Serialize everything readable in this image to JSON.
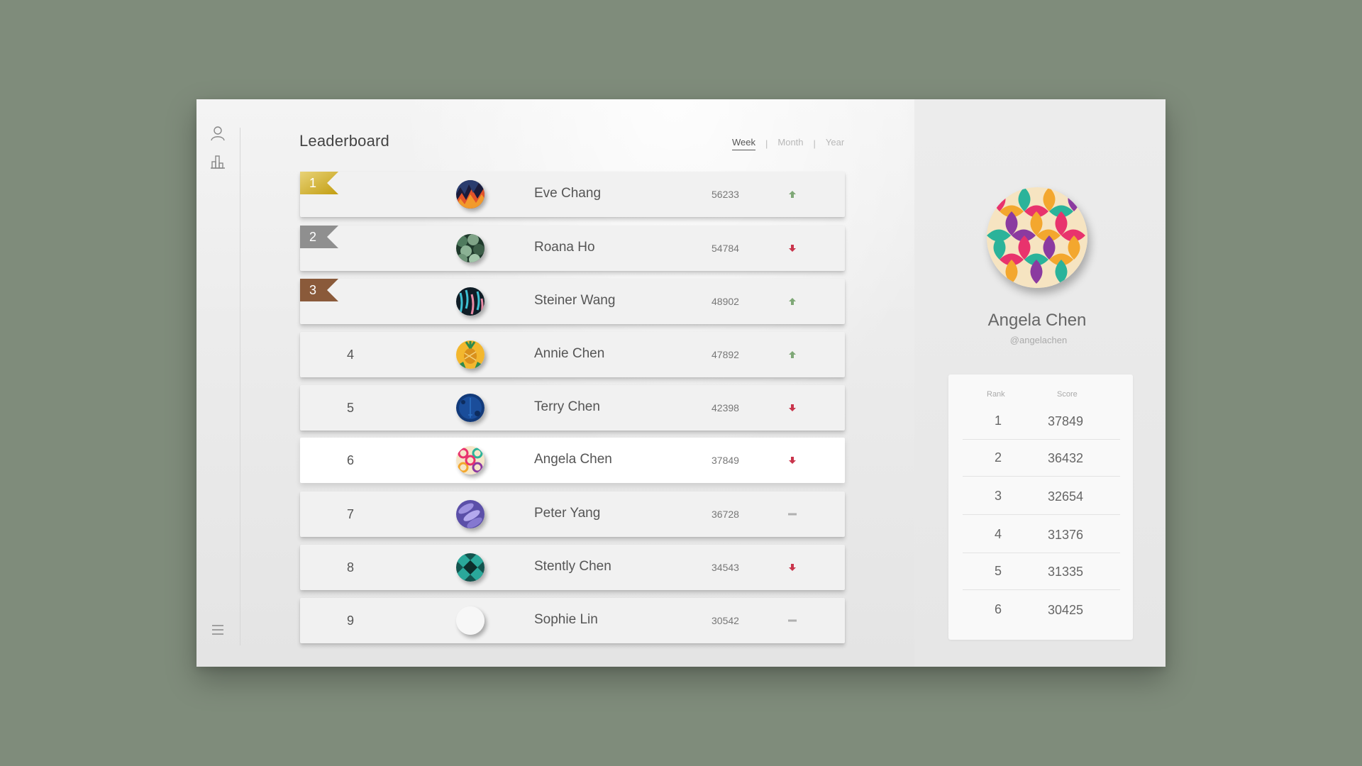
{
  "app": {
    "title": "Leaderboard",
    "period_tabs": [
      {
        "label": "Week",
        "active": true
      },
      {
        "label": "Month",
        "active": false
      },
      {
        "label": "Year",
        "active": false
      }
    ],
    "separator": "|"
  },
  "sidebar": {
    "icons": [
      "user-icon",
      "bar-chart-icon",
      "menu-icon"
    ]
  },
  "colors": {
    "background": "#7f8c7b",
    "gold": "#d9b51c",
    "silver": "#8f8f8f",
    "bronze": "#8a5a3a",
    "trend_up": "#7fa877",
    "trend_down": "#c9344b",
    "trend_same": "#b0b0b0"
  },
  "leaderboard": [
    {
      "rank": "1",
      "name": "Eve Chang",
      "score": "56233",
      "trend": "up",
      "medal": "gold",
      "avatar": "avatar-eve-chang"
    },
    {
      "rank": "2",
      "name": "Roana Ho",
      "score": "54784",
      "trend": "down",
      "medal": "silver",
      "avatar": "avatar-roana-ho"
    },
    {
      "rank": "3",
      "name": "Steiner Wang",
      "score": "48902",
      "trend": "up",
      "medal": "bronze",
      "avatar": "avatar-steiner-wang"
    },
    {
      "rank": "4",
      "name": "Annie Chen",
      "score": "47892",
      "trend": "up",
      "medal": "",
      "avatar": "avatar-annie-chen"
    },
    {
      "rank": "5",
      "name": "Terry Chen",
      "score": "42398",
      "trend": "down",
      "medal": "",
      "avatar": "avatar-terry-chen"
    },
    {
      "rank": "6",
      "name": "Angela Chen",
      "score": "37849",
      "trend": "down",
      "medal": "",
      "avatar": "avatar-angela-chen",
      "highlight": true
    },
    {
      "rank": "7",
      "name": "Peter Yang",
      "score": "36728",
      "trend": "same",
      "medal": "",
      "avatar": "avatar-peter-yang"
    },
    {
      "rank": "8",
      "name": "Stently Chen",
      "score": "34543",
      "trend": "down",
      "medal": "",
      "avatar": "avatar-stently-chen"
    },
    {
      "rank": "9",
      "name": "Sophie Lin",
      "score": "30542",
      "trend": "same",
      "medal": "",
      "avatar": "avatar-sophie-lin"
    }
  ],
  "profile": {
    "name": "Angela Chen",
    "handle": "@angelachen",
    "history_headers": {
      "rank": "Rank",
      "score": "Score"
    },
    "history": [
      {
        "rank": "1",
        "score": "37849"
      },
      {
        "rank": "2",
        "score": "36432"
      },
      {
        "rank": "3",
        "score": "32654"
      },
      {
        "rank": "4",
        "score": "31376"
      },
      {
        "rank": "5",
        "score": "31335"
      },
      {
        "rank": "6",
        "score": "30425"
      }
    ]
  }
}
